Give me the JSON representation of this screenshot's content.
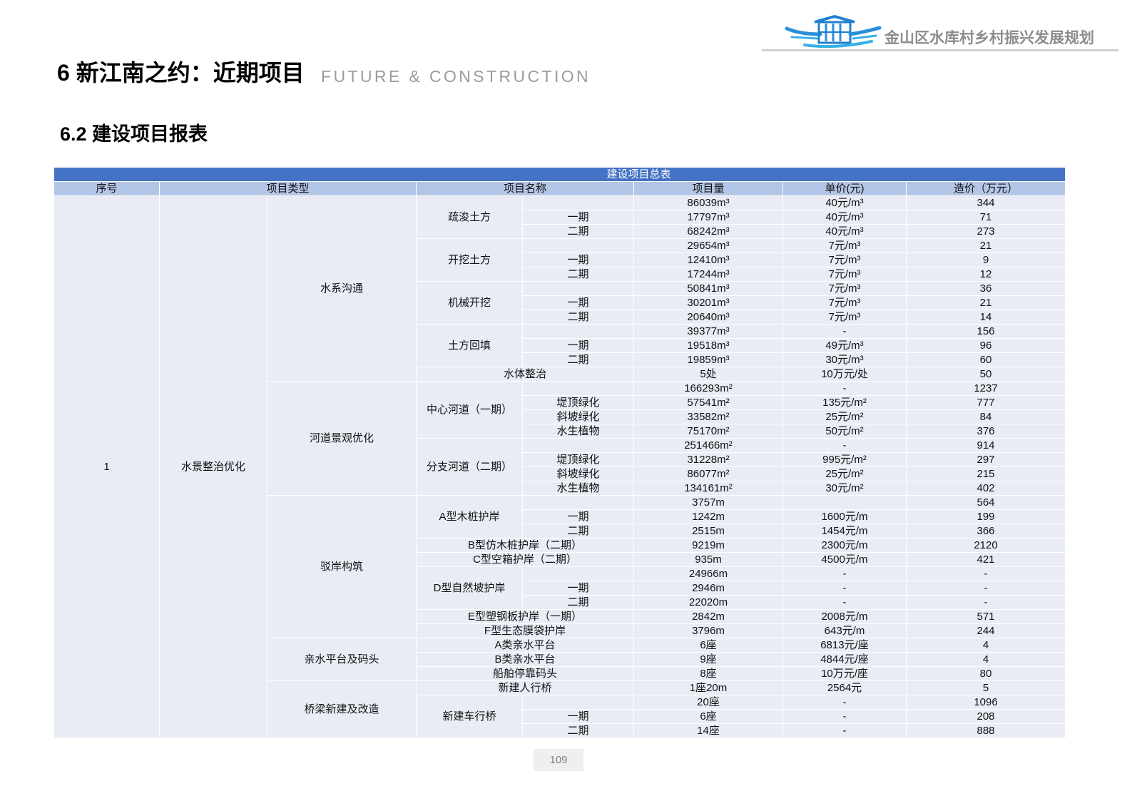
{
  "header": {
    "report_title": "金山区水库村乡村振兴发展规划",
    "logo_icon": "reservoir-village-logo",
    "accent_color": "#2A8FD8"
  },
  "page": {
    "title": "6 新江南之约：近期项目",
    "title_en": "FUTURE & CONSTRUCTION",
    "section_title": "6.2 建设项目报表",
    "page_number": "109"
  },
  "table": {
    "caption": "建设项目总表",
    "colors": {
      "caption_bg": "#4472C4",
      "header_bg": "#B4C6E7",
      "cell_bg": "#E9ECF5"
    },
    "headers": {
      "index": "序号",
      "type": "项目类型",
      "name": "项目名称",
      "quantity": "项目量",
      "unit_price": "单价(元)",
      "cost": "造价（万元）"
    },
    "index": "1",
    "category": "水景整治优化",
    "groups": [
      {
        "name": "水系沟通",
        "items": [
          {
            "name": "疏浚土方",
            "total": {
              "quantity": "86039m³",
              "unit_price": "40元/m³",
              "cost": "344"
            },
            "parts": [
              {
                "label": "一期",
                "quantity": "17797m³",
                "unit_price": "40元/m³",
                "cost": "71"
              },
              {
                "label": "二期",
                "quantity": "68242m³",
                "unit_price": "40元/m³",
                "cost": "273"
              }
            ]
          },
          {
            "name": "开挖土方",
            "total": {
              "quantity": "29654m³",
              "unit_price": "7元/m³",
              "cost": "21"
            },
            "parts": [
              {
                "label": "一期",
                "quantity": "12410m³",
                "unit_price": "7元/m³",
                "cost": "9"
              },
              {
                "label": "二期",
                "quantity": "17244m³",
                "unit_price": "7元/m³",
                "cost": "12"
              }
            ]
          },
          {
            "name": "机械开挖",
            "total": {
              "quantity": "50841m³",
              "unit_price": "7元/m³",
              "cost": "36"
            },
            "parts": [
              {
                "label": "一期",
                "quantity": "30201m³",
                "unit_price": "7元/m³",
                "cost": "21"
              },
              {
                "label": "二期",
                "quantity": "20640m³",
                "unit_price": "7元/m³",
                "cost": "14"
              }
            ]
          },
          {
            "name": "土方回填",
            "total": {
              "quantity": "39377m³",
              "unit_price": "-",
              "cost": "156"
            },
            "parts": [
              {
                "label": "一期",
                "quantity": "19518m³",
                "unit_price": "49元/m³",
                "cost": "96"
              },
              {
                "label": "二期",
                "quantity": "19859m³",
                "unit_price": "30元/m³",
                "cost": "60"
              }
            ]
          },
          {
            "name": "水体整治",
            "quantity": "5处",
            "unit_price": "10万元/处",
            "cost": "50"
          }
        ]
      },
      {
        "name": "河道景观优化",
        "items": [
          {
            "name": "中心河道（一期）",
            "total": {
              "quantity": "166293m²",
              "unit_price": "-",
              "cost": "1237"
            },
            "parts": [
              {
                "label": "堤顶绿化",
                "quantity": "57541m²",
                "unit_price": "135元/m²",
                "cost": "777"
              },
              {
                "label": "斜坡绿化",
                "quantity": "33582m²",
                "unit_price": "25元/m²",
                "cost": "84"
              },
              {
                "label": "水生植物",
                "quantity": "75170m²",
                "unit_price": "50元/m²",
                "cost": "376"
              }
            ]
          },
          {
            "name": "分支河道（二期）",
            "total": {
              "quantity": "251466m²",
              "unit_price": "-",
              "cost": "914"
            },
            "parts": [
              {
                "label": "堤顶绿化",
                "quantity": "31228m²",
                "unit_price": "995元/m²",
                "cost": "297"
              },
              {
                "label": "斜坡绿化",
                "quantity": "86077m²",
                "unit_price": "25元/m²",
                "cost": "215"
              },
              {
                "label": "水生植物",
                "quantity": "134161m²",
                "unit_price": "30元/m²",
                "cost": "402"
              }
            ]
          }
        ]
      },
      {
        "name": "驳岸构筑",
        "items": [
          {
            "name": "A型木桩护岸",
            "total": {
              "quantity": "3757m",
              "cost": "564"
            },
            "parts": [
              {
                "label": "一期",
                "quantity": "1242m",
                "unit_price": "1600元/m",
                "cost": "199"
              },
              {
                "label": "二期",
                "quantity": "2515m",
                "unit_price": "1454元/m",
                "cost": "366"
              }
            ]
          },
          {
            "name": "B型仿木桩护岸（二期）",
            "quantity": "9219m",
            "unit_price": "2300元/m",
            "cost": "2120"
          },
          {
            "name": "C型空箱护岸（二期）",
            "quantity": "935m",
            "unit_price": "4500元/m",
            "cost": "421"
          },
          {
            "name": "D型自然坡护岸",
            "total": {
              "quantity": "24966m",
              "unit_price": "-",
              "cost": "-"
            },
            "parts": [
              {
                "label": "一期",
                "quantity": "2946m",
                "unit_price": "-",
                "cost": "-"
              },
              {
                "label": "二期",
                "quantity": "22020m",
                "unit_price": "-",
                "cost": "-"
              }
            ]
          },
          {
            "name": "E型塑钢板护岸（一期）",
            "quantity": "2842m",
            "unit_price": "2008元/m",
            "cost": "571"
          },
          {
            "name": "F型生态膜袋护岸",
            "quantity": "3796m",
            "unit_price": "643元/m",
            "cost": "244"
          }
        ]
      },
      {
        "name": "亲水平台及码头",
        "items": [
          {
            "name": "A类亲水平台",
            "quantity": "6座",
            "unit_price": "6813元/座",
            "cost": "4"
          },
          {
            "name": "B类亲水平台",
            "quantity": "9座",
            "unit_price": "4844元/座",
            "cost": "4"
          },
          {
            "name": "船舶停靠码头",
            "quantity": "8座",
            "unit_price": "10万元/座",
            "cost": "80"
          }
        ]
      },
      {
        "name": "桥梁新建及改造",
        "items": [
          {
            "name": "新建人行桥",
            "quantity": "1座20m",
            "unit_price": "2564元",
            "cost": "5"
          },
          {
            "name": "新建车行桥",
            "total": {
              "quantity": "20座",
              "unit_price": "-",
              "cost": "1096"
            },
            "parts": [
              {
                "label": "一期",
                "quantity": "6座",
                "unit_price": "-",
                "cost": "208"
              },
              {
                "label": "二期",
                "quantity": "14座",
                "unit_price": "-",
                "cost": "888"
              }
            ]
          }
        ]
      }
    ]
  }
}
